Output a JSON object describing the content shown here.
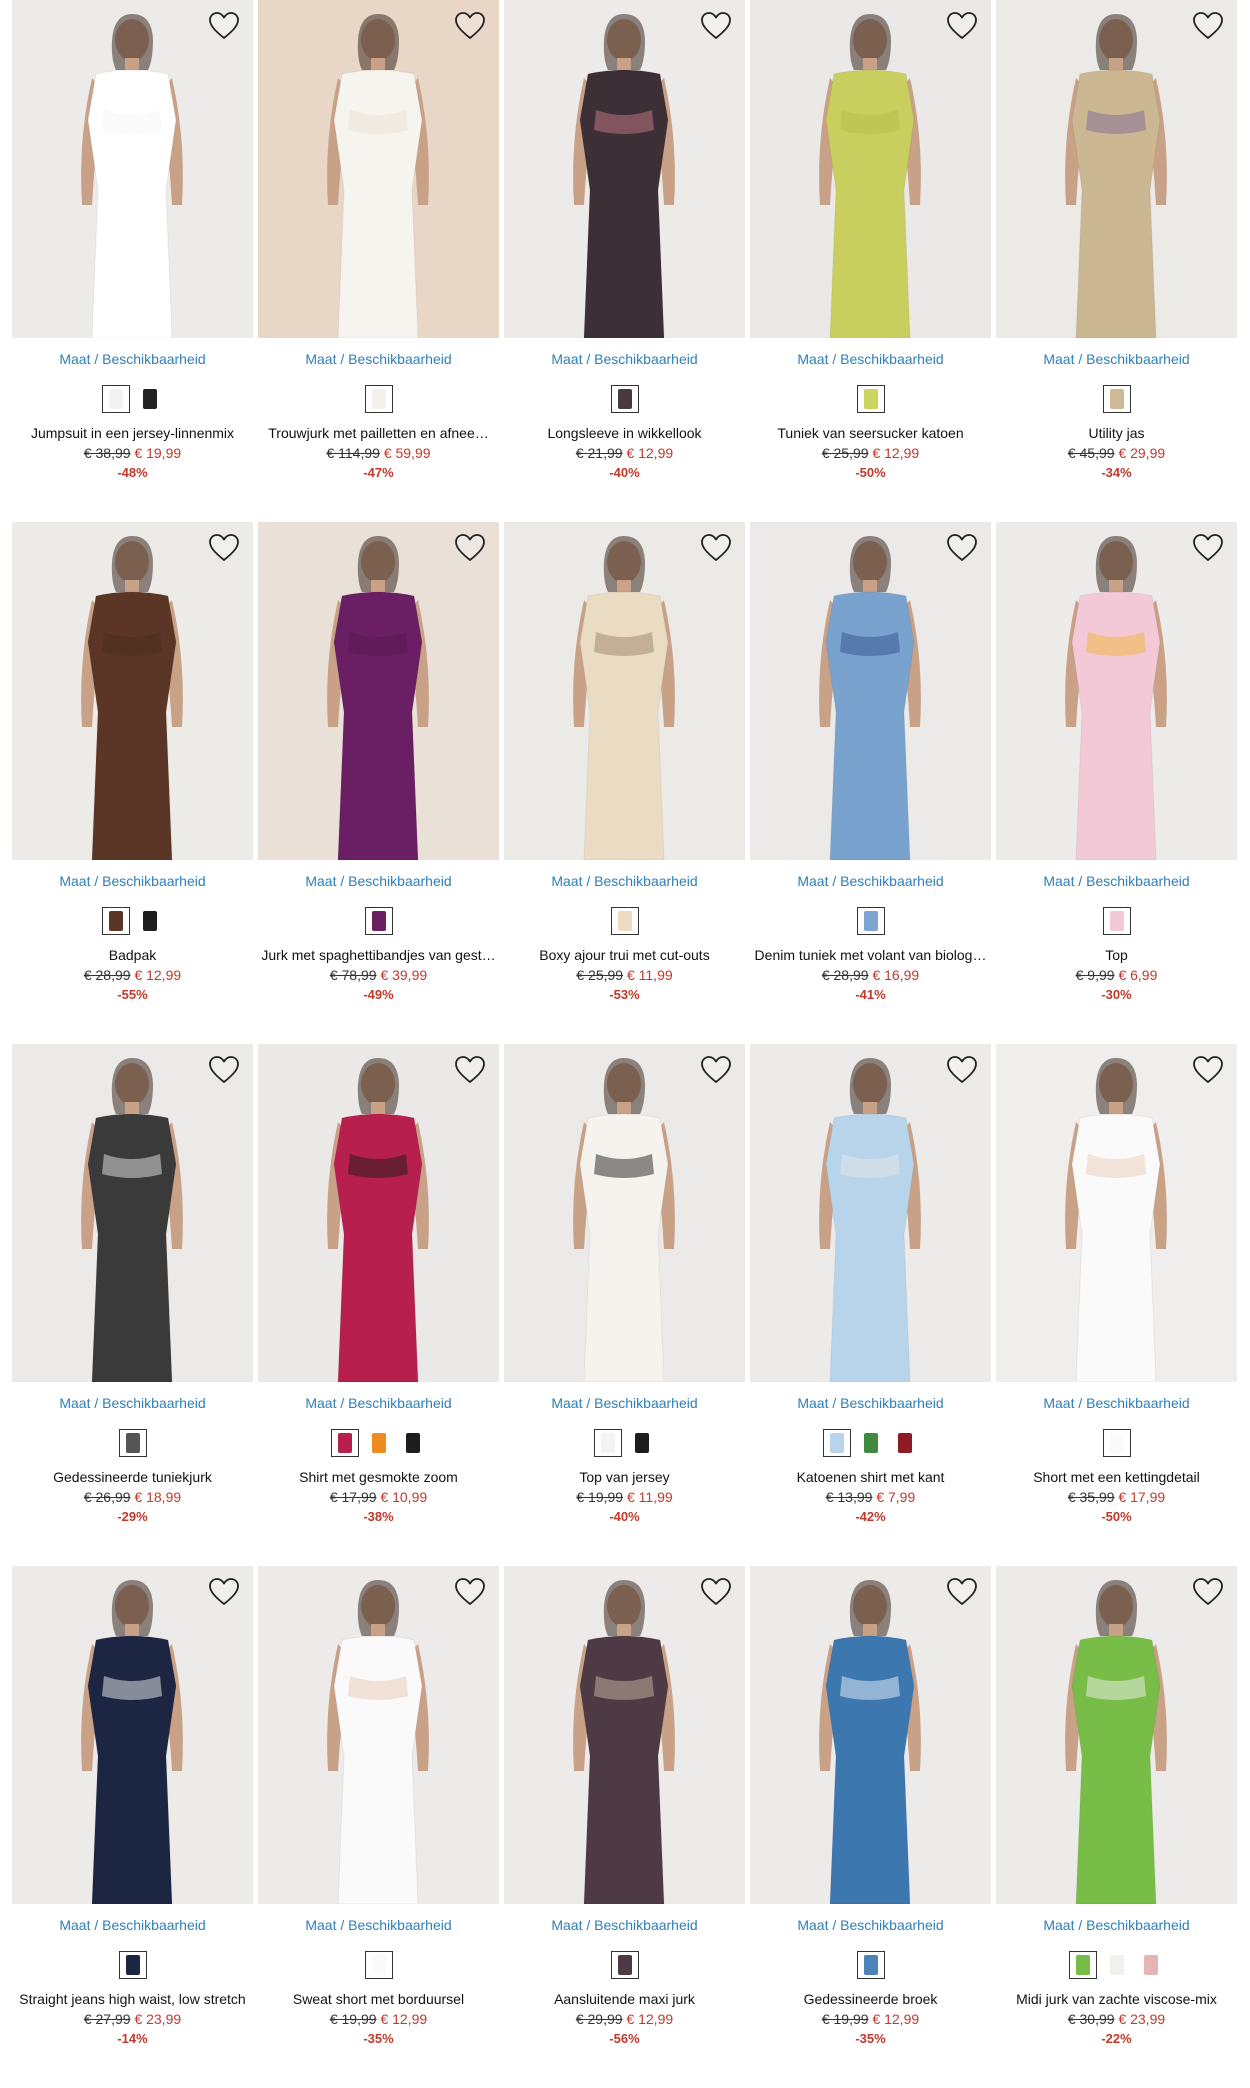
{
  "availability_label": "Maat / Beschikbaarheid",
  "products": [
    {
      "name": "Jumpsuit in een jersey-linnenmix",
      "old_price": "€ 38,99",
      "new_price": "€ 19,99",
      "discount": "-48%",
      "bg": "#ecebea",
      "garment": "#ffffff",
      "accent": "#f5f5f5",
      "swatches": [
        "#f3f3f3",
        "#222222"
      ]
    },
    {
      "name": "Trouwjurk met pailletten en afnee…",
      "old_price": "€ 114,99",
      "new_price": "€ 59,99",
      "discount": "-47%",
      "bg": "#e8d6c6",
      "garment": "#f6f4ee",
      "accent": "#e9e2d3",
      "swatches": [
        "#f3f1ea"
      ]
    },
    {
      "name": "Longsleeve in wikkellook",
      "old_price": "€ 21,99",
      "new_price": "€ 12,99",
      "discount": "-40%",
      "bg": "#ecebe9",
      "garment": "#3d2f36",
      "accent": "#c57a86",
      "swatches": [
        "#4a3a3f"
      ]
    },
    {
      "name": "Tuniek van seersucker katoen",
      "old_price": "€ 25,99",
      "new_price": "€ 12,99",
      "discount": "-50%",
      "bg": "#eae9e7",
      "garment": "#c9cf5e",
      "accent": "#b7bd4c",
      "swatches": [
        "#cdd35f"
      ]
    },
    {
      "name": "Utility jas",
      "old_price": "€ 45,99",
      "new_price": "€ 29,99",
      "discount": "-34%",
      "bg": "#ebeae7",
      "garment": "#cbb792",
      "accent": "#7d6b9a",
      "swatches": [
        "#cdbb95"
      ]
    },
    {
      "name": "Badpak",
      "old_price": "€ 28,99",
      "new_price": "€ 12,99",
      "discount": "-55%",
      "bg": "#ecebe8",
      "garment": "#5b3627",
      "accent": "#4a2b1f",
      "swatches": [
        "#5b3627",
        "#1d1d1d"
      ]
    },
    {
      "name": "Jurk met spaghettibandjes van gest…",
      "old_price": "€ 78,99",
      "new_price": "€ 39,99",
      "discount": "-49%",
      "bg": "#e9e1d8",
      "garment": "#6a1e63",
      "accent": "#561751",
      "swatches": [
        "#6a1e63"
      ]
    },
    {
      "name": "Boxy ajour trui met cut-outs",
      "old_price": "€ 25,99",
      "new_price": "€ 11,99",
      "discount": "-53%",
      "bg": "#eceae7",
      "garment": "#eadcc2",
      "accent": "#9c8267",
      "swatches": [
        "#ecdcc4"
      ]
    },
    {
      "name": "Denim tuniek met volant van biolog…",
      "old_price": "€ 28,99",
      "new_price": "€ 16,99",
      "discount": "-41%",
      "bg": "#ebeae8",
      "garment": "#7aa2cf",
      "accent": "#31508d",
      "swatches": [
        "#7ea5d2"
      ]
    },
    {
      "name": "Top",
      "old_price": "€ 9,99",
      "new_price": "€ 6,99",
      "discount": "-30%",
      "bg": "#ecebe9",
      "garment": "#f3c8d7",
      "accent": "#f2b63a",
      "swatches": [
        "#f3c9d8"
      ]
    },
    {
      "name": "Gedessineerde tuniekjurk",
      "old_price": "€ 26,99",
      "new_price": "€ 18,99",
      "discount": "-29%",
      "bg": "#eceae8",
      "garment": "#3a3a3a",
      "accent": "#e8e8e8",
      "swatches": [
        "#555555"
      ]
    },
    {
      "name": "Shirt met gesmokte zoom",
      "old_price": "€ 17,99",
      "new_price": "€ 10,99",
      "discount": "-38%",
      "bg": "#eae9e7",
      "garment": "#b71f4e",
      "accent": "#1d1d1d",
      "swatches": [
        "#b71f4e",
        "#f08c1e",
        "#1d1d1d"
      ]
    },
    {
      "name": "Top van jersey",
      "old_price": "€ 19,99",
      "new_price": "€ 11,99",
      "discount": "-40%",
      "bg": "#ebeae8",
      "garment": "#f6f3ee",
      "accent": "#1f1f1f",
      "swatches": [
        "#f4f4f4",
        "#1d1d1d"
      ]
    },
    {
      "name": "Katoenen shirt met kant",
      "old_price": "€ 13,99",
      "new_price": "€ 7,99",
      "discount": "-42%",
      "bg": "#ecebe9",
      "garment": "#b8d4ea",
      "accent": "#e6e6e6",
      "swatches": [
        "#b8d4ea",
        "#3f8a3f",
        "#8f1b23"
      ]
    },
    {
      "name": "Short met een kettingdetail",
      "old_price": "€ 35,99",
      "new_price": "€ 17,99",
      "discount": "-50%",
      "bg": "#efeeec",
      "garment": "#fafafa",
      "accent": "#e9cdb5",
      "swatches": [
        "#fafafa"
      ]
    },
    {
      "name": "Straight jeans high waist, low stretch",
      "old_price": "€ 27,99",
      "new_price": "€ 23,99",
      "discount": "-14%",
      "bg": "#ecebe9",
      "garment": "#1c2642",
      "accent": "#f2f2f2",
      "swatches": [
        "#1c2642"
      ]
    },
    {
      "name": "Sweat short met borduursel",
      "old_price": "€ 19,99",
      "new_price": "€ 12,99",
      "discount": "-35%",
      "bg": "#ecebe9",
      "garment": "#fafafa",
      "accent": "#e8c8b1",
      "swatches": [
        "#fafafa"
      ]
    },
    {
      "name": "Aansluitende maxi jurk",
      "old_price": "€ 29,99",
      "new_price": "€ 12,99",
      "discount": "-56%",
      "bg": "#ecebe9",
      "garment": "#4e3a44",
      "accent": "#c9b7a4",
      "swatches": [
        "#4e3a44"
      ]
    },
    {
      "name": "Gedessineerde broek",
      "old_price": "€ 19,99",
      "new_price": "€ 12,99",
      "discount": "-35%",
      "bg": "#ecebe9",
      "garment": "#3d77b0",
      "accent": "#e9f1f7",
      "swatches": [
        "#4b82b8"
      ]
    },
    {
      "name": "Midi jurk van zachte viscose-mix",
      "old_price": "€ 30,99",
      "new_price": "€ 23,99",
      "discount": "-22%",
      "bg": "#ecebe9",
      "garment": "#78bd47",
      "accent": "#f1f1f1",
      "swatches": [
        "#78bd47",
        "#f0f0ec",
        "#e5b5b5"
      ]
    }
  ]
}
